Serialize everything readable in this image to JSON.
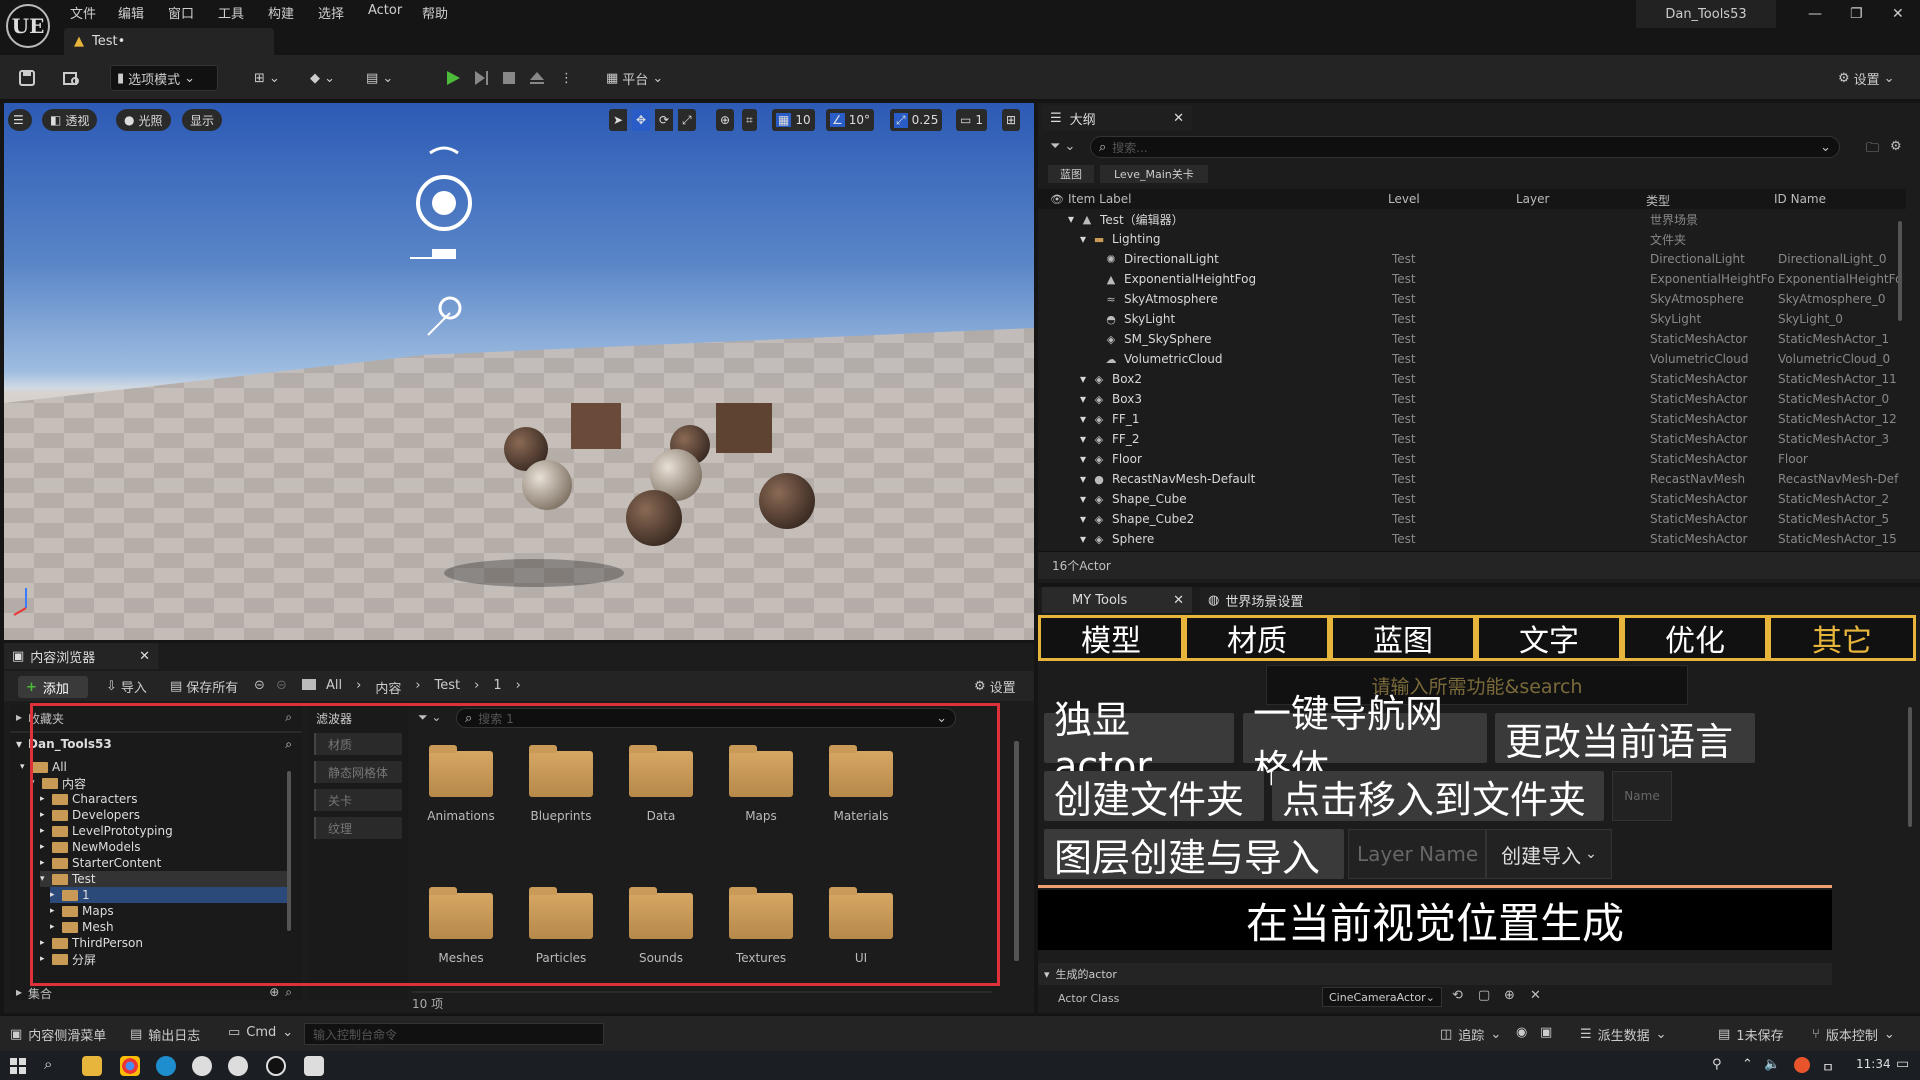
{
  "titlebar": {
    "logo": "UE",
    "menu": [
      "文件",
      "编辑",
      "窗口",
      "工具",
      "构建",
      "选择",
      "Actor",
      "帮助"
    ],
    "doc_tab": "Test•",
    "project_name": "Dan_Tools53",
    "win_controls": [
      "—",
      "❐",
      "✕"
    ]
  },
  "toolbar": {
    "mode_label": "选项模式",
    "platform_label": "平台",
    "settings_label": "设置"
  },
  "viewport": {
    "chips": [
      "透视",
      "光照",
      "显示"
    ],
    "grid_value": "10",
    "angle_value": "10°",
    "scale_value": "0.25",
    "camera_speed": "1"
  },
  "outliner": {
    "tab_label": "大纲",
    "search_placeholder": "搜索...",
    "filter_tabs": [
      "蓝图",
      "Leve_Main关卡"
    ],
    "columns": [
      "Item Label",
      "Level",
      "Layer",
      "类型",
      "ID Name"
    ],
    "rows": [
      {
        "label": "Test（编辑器）",
        "level": "",
        "type": "世界场景",
        "id": "",
        "indent": 0,
        "icon": "world-icon"
      },
      {
        "label": "Lighting",
        "level": "",
        "type": "文件夹",
        "id": "",
        "indent": 1,
        "icon": "folder-icon"
      },
      {
        "label": "DirectionalLight",
        "level": "Test",
        "type": "DirectionalLight",
        "id": "DirectionalLight_0",
        "indent": 2,
        "icon": "sun-icon"
      },
      {
        "label": "ExponentialHeightFog",
        "level": "Test",
        "type": "ExponentialHeightFog",
        "id": "ExponentialHeightFog",
        "indent": 2,
        "icon": "fog-icon"
      },
      {
        "label": "SkyAtmosphere",
        "level": "Test",
        "type": "SkyAtmosphere",
        "id": "SkyAtmosphere_0",
        "indent": 2,
        "icon": "sky-icon"
      },
      {
        "label": "SkyLight",
        "level": "Test",
        "type": "SkyLight",
        "id": "SkyLight_0",
        "indent": 2,
        "icon": "skylight-icon"
      },
      {
        "label": "SM_SkySphere",
        "level": "Test",
        "type": "StaticMeshActor",
        "id": "StaticMeshActor_1",
        "indent": 2,
        "icon": "mesh-icon"
      },
      {
        "label": "VolumetricCloud",
        "level": "Test",
        "type": "VolumetricCloud",
        "id": "VolumetricCloud_0",
        "indent": 2,
        "icon": "cloud-icon"
      },
      {
        "label": "Box2",
        "level": "Test",
        "type": "StaticMeshActor",
        "id": "StaticMeshActor_11",
        "indent": 1,
        "icon": "mesh-icon"
      },
      {
        "label": "Box3",
        "level": "Test",
        "type": "StaticMeshActor",
        "id": "StaticMeshActor_0",
        "indent": 1,
        "icon": "mesh-icon"
      },
      {
        "label": "FF_1",
        "level": "Test",
        "type": "StaticMeshActor",
        "id": "StaticMeshActor_12",
        "indent": 1,
        "icon": "mesh-icon"
      },
      {
        "label": "FF_2",
        "level": "Test",
        "type": "StaticMeshActor",
        "id": "StaticMeshActor_3",
        "indent": 1,
        "icon": "mesh-icon"
      },
      {
        "label": "Floor",
        "level": "Test",
        "type": "StaticMeshActor",
        "id": "Floor",
        "indent": 1,
        "icon": "mesh-icon"
      },
      {
        "label": "RecastNavMesh-Default",
        "level": "Test",
        "type": "RecastNavMesh",
        "id": "RecastNavMesh-Def",
        "indent": 1,
        "icon": "navmesh-icon"
      },
      {
        "label": "Shape_Cube",
        "level": "Test",
        "type": "StaticMeshActor",
        "id": "StaticMeshActor_2",
        "indent": 1,
        "icon": "mesh-icon"
      },
      {
        "label": "Shape_Cube2",
        "level": "Test",
        "type": "StaticMeshActor",
        "id": "StaticMeshActor_5",
        "indent": 1,
        "icon": "mesh-icon"
      },
      {
        "label": "Sphere",
        "level": "Test",
        "type": "StaticMeshActor",
        "id": "StaticMeshActor_15",
        "indent": 1,
        "icon": "mesh-icon"
      }
    ],
    "actor_count": "16个Actor"
  },
  "mytools": {
    "tab_label": "MY Tools",
    "world_tab_label": "世界场景设置",
    "categories": [
      "模型",
      "材质",
      "蓝图",
      "文字",
      "优化",
      "其它"
    ],
    "search_placeholder": "请输入所需功能&search",
    "btn_isolate": "独显actor",
    "btn_navmesh": "一键导航网格体",
    "btn_language": "更改当前语言",
    "btn_create_folder": "创建文件夹",
    "btn_move_folder": "点击移入到文件夹",
    "name_placeholder": "Name",
    "btn_layer": "图层创建与导入",
    "layer_placeholder": "Layer Name",
    "btn_create_import": "创建导入",
    "btn_spawn": "在当前视觉位置生成",
    "section_label": "生成的actor",
    "actor_class_label": "Actor Class",
    "actor_class_value": "CineCameraActor"
  },
  "cbrowser": {
    "tab_label": "内容浏览器",
    "add_label": "添加",
    "import_label": "导入",
    "save_all_label": "保存所有",
    "breadcrumb": [
      "All",
      "内容",
      "Test",
      "1"
    ],
    "settings_label": "设置",
    "favorites_label": "收藏夹",
    "project_label": "Dan_Tools53",
    "tree": [
      {
        "label": "All",
        "indent": 0
      },
      {
        "label": "内容",
        "indent": 1
      },
      {
        "label": "Characters",
        "indent": 2
      },
      {
        "label": "Developers",
        "indent": 2
      },
      {
        "label": "LevelPrototyping",
        "indent": 2
      },
      {
        "label": "NewModels",
        "indent": 2
      },
      {
        "label": "StarterContent",
        "indent": 2
      },
      {
        "label": "Test",
        "indent": 2
      },
      {
        "label": "1",
        "indent": 3
      },
      {
        "label": "Maps",
        "indent": 3
      },
      {
        "label": "Mesh",
        "indent": 3
      },
      {
        "label": "ThirdPerson",
        "indent": 2
      },
      {
        "label": "分屏",
        "indent": 2
      }
    ],
    "collections_label": "集合",
    "filters_label": "滤波器",
    "filters": [
      "材质",
      "静态网格体",
      "关卡",
      "纹理"
    ],
    "search_placeholder": "搜索 1",
    "folders": [
      "Animations",
      "Blueprints",
      "Data",
      "Maps",
      "Materials",
      "Meshes",
      "Particles",
      "Sounds",
      "Textures",
      "UI"
    ],
    "item_count": "10 项"
  },
  "statusbar": {
    "drawer": "内容侧滑菜单",
    "output_log": "输出日志",
    "cmd": "Cmd",
    "console_placeholder": "输入控制台命令",
    "trace": "追踪",
    "derived_data": "派生数据",
    "unsaved": "1未保存",
    "source_control": "版本控制"
  },
  "taskbar": {
    "time": "11:34"
  },
  "colors": {
    "accent": "#e7b53b",
    "highlight_red": "#e0303a",
    "orange_line": "#f0a070"
  }
}
